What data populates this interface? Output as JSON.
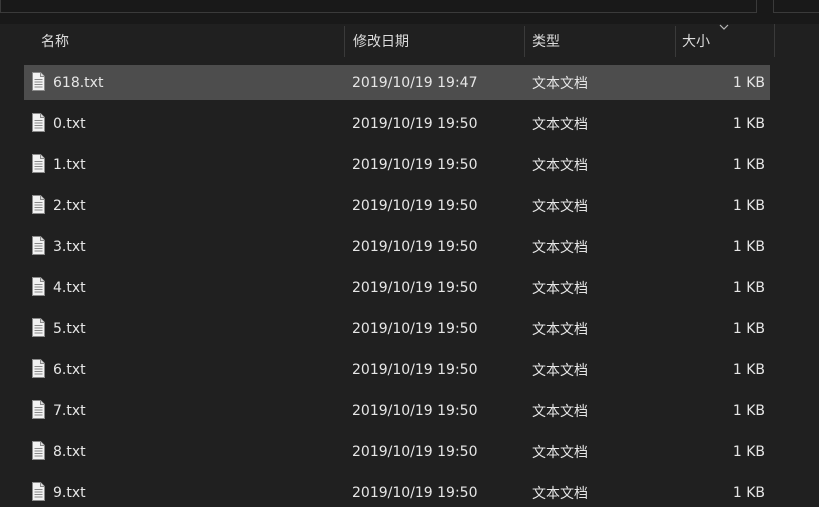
{
  "columns": {
    "name": "名称",
    "modified": "修改日期",
    "type": "类型",
    "size": "大小"
  },
  "icons": {
    "file": "text-file-icon",
    "sort": "chevron-down-icon"
  },
  "colors": {
    "background": "#202020",
    "selected_row": "#4d4d4d",
    "text": "#e6e6e6"
  },
  "files": [
    {
      "name": "618.txt",
      "modified": "2019/10/19 19:47",
      "type": "文本文档",
      "size": "1 KB",
      "selected": true
    },
    {
      "name": "0.txt",
      "modified": "2019/10/19 19:50",
      "type": "文本文档",
      "size": "1 KB"
    },
    {
      "name": "1.txt",
      "modified": "2019/10/19 19:50",
      "type": "文本文档",
      "size": "1 KB"
    },
    {
      "name": "2.txt",
      "modified": "2019/10/19 19:50",
      "type": "文本文档",
      "size": "1 KB"
    },
    {
      "name": "3.txt",
      "modified": "2019/10/19 19:50",
      "type": "文本文档",
      "size": "1 KB"
    },
    {
      "name": "4.txt",
      "modified": "2019/10/19 19:50",
      "type": "文本文档",
      "size": "1 KB"
    },
    {
      "name": "5.txt",
      "modified": "2019/10/19 19:50",
      "type": "文本文档",
      "size": "1 KB"
    },
    {
      "name": "6.txt",
      "modified": "2019/10/19 19:50",
      "type": "文本文档",
      "size": "1 KB"
    },
    {
      "name": "7.txt",
      "modified": "2019/10/19 19:50",
      "type": "文本文档",
      "size": "1 KB"
    },
    {
      "name": "8.txt",
      "modified": "2019/10/19 19:50",
      "type": "文本文档",
      "size": "1 KB"
    },
    {
      "name": "9.txt",
      "modified": "2019/10/19 19:50",
      "type": "文本文档",
      "size": "1 KB"
    }
  ]
}
